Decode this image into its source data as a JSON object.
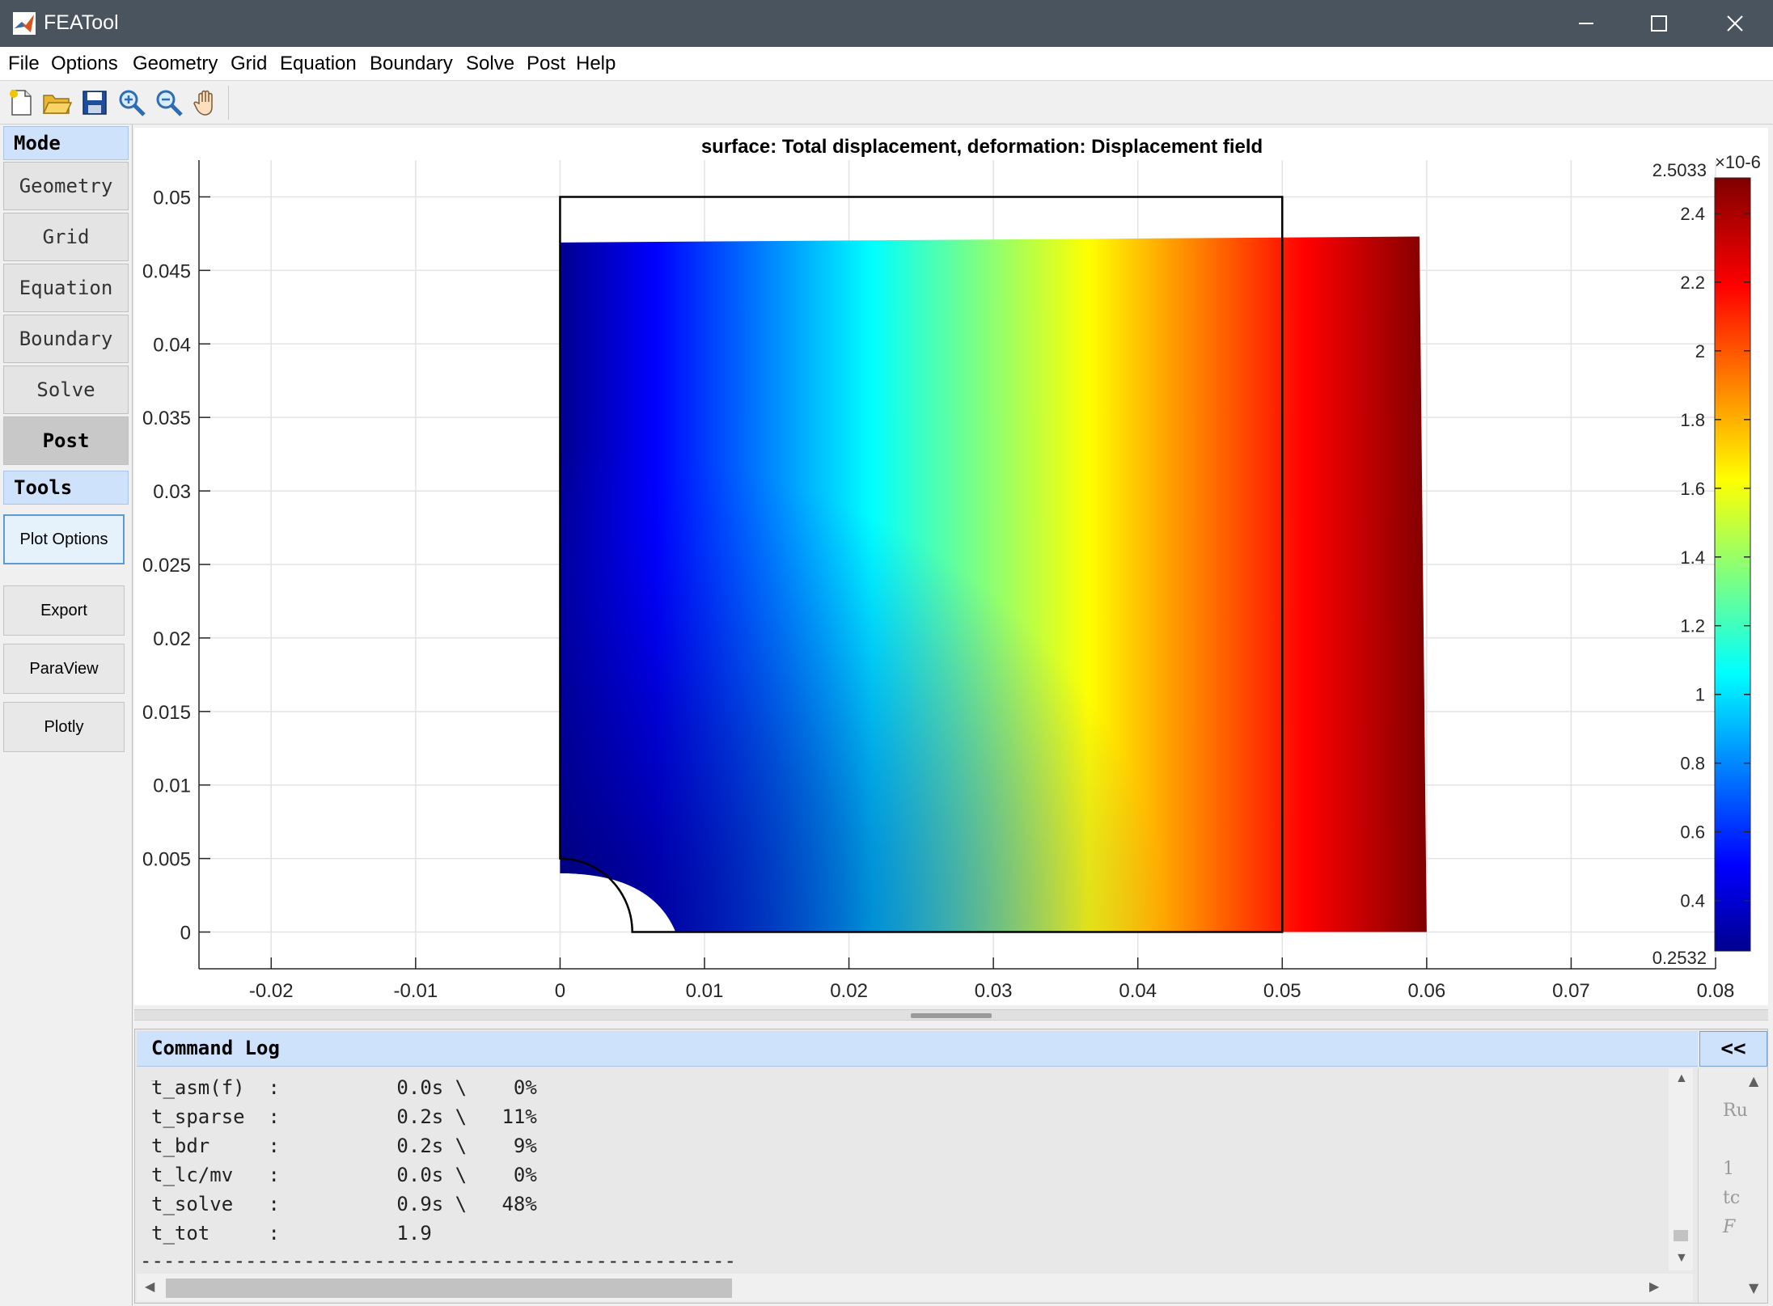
{
  "window": {
    "title": "FEATool"
  },
  "menu": [
    "File",
    "Options",
    "Geometry",
    "Grid",
    "Equation",
    "Boundary",
    "Solve",
    "Post",
    "Help"
  ],
  "toolbar": {
    "icons": [
      "new-file-icon",
      "open-folder-icon",
      "save-disk-icon",
      "zoom-in-icon",
      "zoom-out-icon",
      "pan-hand-icon"
    ]
  },
  "left": {
    "mode_header": "Mode",
    "modes": [
      "Geometry",
      "Grid",
      "Equation",
      "Boundary",
      "Solve",
      "Post"
    ],
    "active_mode": "Post",
    "tools_header": "Tools",
    "tools": [
      "Plot Options",
      "Export",
      "ParaView",
      "Plotly"
    ]
  },
  "chart_data": {
    "type": "heatmap",
    "title": "surface: Total displacement, deformation: Displacement field",
    "xlim": [
      -0.025,
      0.08
    ],
    "ylim": [
      -0.0025,
      0.0525
    ],
    "xticks": [
      -0.02,
      -0.01,
      0,
      0.01,
      0.02,
      0.03,
      0.04,
      0.05,
      0.06,
      0.07,
      0.08
    ],
    "xtick_labels": [
      "-0.02",
      "-0.01",
      "0",
      "0.01",
      "0.02",
      "0.03",
      "0.04",
      "0.05",
      "0.06",
      "0.07",
      "0.08"
    ],
    "yticks": [
      0,
      0.005,
      0.01,
      0.015,
      0.02,
      0.025,
      0.03,
      0.035,
      0.04,
      0.045,
      0.05
    ],
    "ytick_labels": [
      "0",
      "0.005",
      "0.01",
      "0.015",
      "0.02",
      "0.025",
      "0.03",
      "0.035",
      "0.04",
      "0.045",
      "0.05"
    ],
    "grid": true,
    "undeformed_outline": {
      "x_min": 0,
      "x_max": 0.05,
      "y_min": 0,
      "y_max": 0.05,
      "hole_radius": 0.005
    },
    "deformed_domain": {
      "top_left": [
        0,
        0.0469
      ],
      "top_right": [
        0.0595,
        0.0473
      ],
      "bottom_right": [
        0.06,
        0
      ],
      "hole_bottom_x": 0.008,
      "hole_left_y": 0.004
    },
    "colorbar": {
      "colormap": "jet",
      "min": 0.2532,
      "max": 2.5033,
      "min_label": "0.2532",
      "max_label": "2.5033",
      "exponent": "×10-6",
      "ticks": [
        0.4,
        0.6,
        0.8,
        1,
        1.2,
        1.4,
        1.6,
        1.8,
        2,
        2.2,
        2.4
      ],
      "tick_labels": [
        "0.4",
        "0.6",
        "0.8",
        "1",
        "1.2",
        "1.4",
        "1.6",
        "1.8",
        "2",
        "2.2",
        "2.4"
      ]
    }
  },
  "log": {
    "header": "Command Log",
    "collapse_label": "<<",
    "lines": [
      "t_asm(f)  :          0.0s \\    0%",
      "t_sparse  :          0.2s \\   11%",
      "t_bdr     :          0.2s \\    9%",
      "t_lc/mv   :          0.0s \\    0%",
      "t_solve   :          0.9s \\   48%",
      "t_tot     :          1.9",
      "---------------------------------------------------"
    ],
    "side_fragments": [
      "Ru",
      "1",
      "tc",
      "F"
    ]
  }
}
